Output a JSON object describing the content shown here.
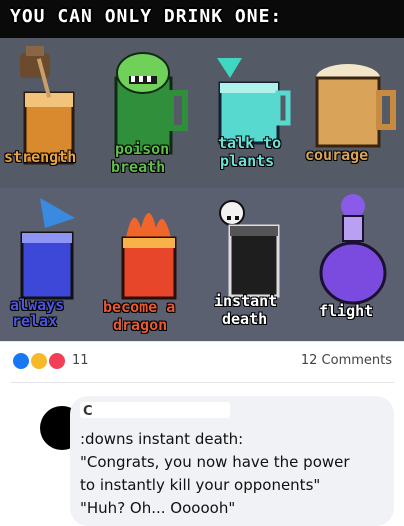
{
  "meme": {
    "title": "YOU CAN ONLY DRINK ONE:",
    "drinks": [
      {
        "label_lines": [
          "strength"
        ],
        "color": "#e8a440"
      },
      {
        "label_lines": [
          "poison",
          "breath"
        ],
        "color": "#5fbf4a"
      },
      {
        "label_lines": [
          "talk to",
          "plants"
        ],
        "color": "#6ee0d6"
      },
      {
        "label_lines": [
          "courage"
        ],
        "color": "#d9a35a"
      },
      {
        "label_lines": [
          "always",
          "relax"
        ],
        "color": "#4a55e8"
      },
      {
        "label_lines": [
          "become a",
          "dragon"
        ],
        "color": "#e85a32"
      },
      {
        "label_lines": [
          "instant",
          "death"
        ],
        "color": "#ffffff"
      },
      {
        "label_lines": [
          "flight"
        ],
        "color": "#9b6cf0"
      }
    ]
  },
  "post": {
    "reactions": {
      "count": "11",
      "icons": [
        "like-icon",
        "haha-icon",
        "love-icon"
      ]
    },
    "comments_label": "12 Comments"
  },
  "comment": {
    "author": "C",
    "lines": [
      ":downs instant death:",
      "\"Congrats, you now have the power",
      "to instantly kill your opponents\"",
      "\"Huh? Oh... Oooooh\""
    ]
  }
}
